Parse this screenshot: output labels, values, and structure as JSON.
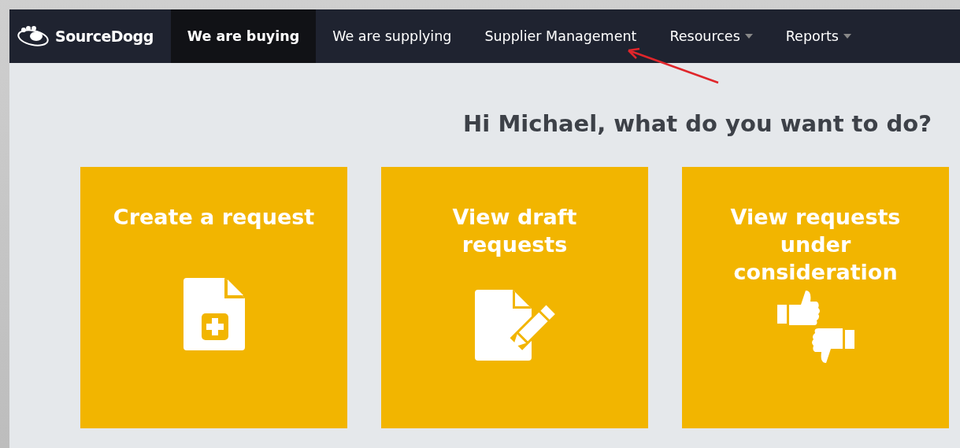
{
  "navbar": {
    "logo": "SourceDogg",
    "items": [
      {
        "label": "We are buying",
        "selected": true,
        "dropdown": false
      },
      {
        "label": "We are supplying",
        "selected": false,
        "dropdown": false
      },
      {
        "label": "Supplier Management",
        "selected": false,
        "dropdown": false
      },
      {
        "label": "Resources",
        "selected": false,
        "dropdown": true
      },
      {
        "label": "Reports",
        "selected": false,
        "dropdown": true
      }
    ]
  },
  "heading": "Hi Michael, what do you want to do?",
  "cards": [
    {
      "title": "Create a request",
      "kind": "new-document"
    },
    {
      "title": "View draft requests",
      "kind": "edit-document"
    },
    {
      "title": "View requests under consideration",
      "kind": "thumbs"
    }
  ]
}
